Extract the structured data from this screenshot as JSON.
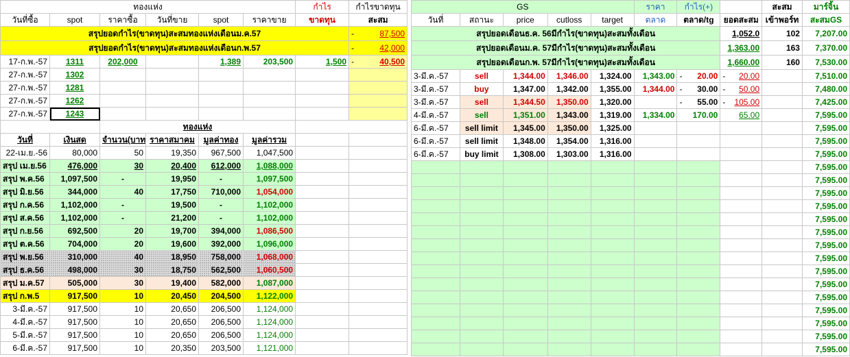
{
  "left": {
    "header1": {
      "gold": "ทองแห่ง",
      "profit": "กำไร",
      "profit_loss": "กำไรขาดทุน"
    },
    "header2": {
      "buy_date": "วันที่ซื้อ",
      "spot1": "spot",
      "buy_price": "ราคาซื้อ",
      "sell_date": "วันที่ขาย",
      "spot2": "spot",
      "sell_price": "ราคาขาย",
      "loss": "ขาดทุน",
      "cum": "สะสม"
    },
    "summary_rows": [
      {
        "label": "สรุปยอดกำไร(ขาดทุน)สะสมทองแห่งเดือนม.ค.57",
        "dash": "-",
        "value": "87,500"
      },
      {
        "label": "สรุปยอดกำไร(ขาดทุน)สะสมทองแห่งเดือนก.พ.57",
        "dash": "-",
        "value": "42,000"
      }
    ],
    "trade_rows": [
      {
        "date": "17-ก.พ.-57",
        "spot": "1311",
        "buy": "202,000",
        "sdate": "",
        "spot2": "1,389",
        "sell": "203,500",
        "pl": "1,500",
        "dash": "-",
        "cum": "40,500"
      },
      {
        "date": "27-ก.พ.-57",
        "spot": "1302"
      },
      {
        "date": "27-ก.พ.-57",
        "spot": "1281"
      },
      {
        "date": "27-ก.พ.-57",
        "spot": "1262"
      },
      {
        "date": "27-ก.พ.-57",
        "spot": "1243"
      }
    ],
    "gold_section_title": "ทองแห่ง",
    "gold_headers": {
      "date": "วันที่",
      "cash": "เงินสด",
      "qty": "จำนวน(บาท",
      "assoc": "ราคาสมาคม",
      "gold_value": "มูลค่าทอง",
      "total_value": "มูลค่ารวม"
    },
    "gold_rows": [
      {
        "date": "22-เม.ย.-56",
        "cash": "80,000",
        "qty": "50",
        "assoc": "19,350",
        "gv": "967,500",
        "tv": "1,047,500",
        "style": "plain"
      },
      {
        "date": "สรุป เม.ย.56",
        "cash": "476,000",
        "qty": "30",
        "assoc": "20,400",
        "gv": "612,000",
        "tv": "1,088,000",
        "style": "green-u",
        "tvc": "grn"
      },
      {
        "date": "สรุป พ.ค.56",
        "cash": "1,097,500",
        "qty": "-",
        "assoc": "19,950",
        "gv": "-",
        "tv": "1,097,500",
        "style": "green",
        "tvc": "grn"
      },
      {
        "date": "สรุป มิ.ย.56",
        "cash": "344,000",
        "qty": "40",
        "assoc": "17,750",
        "gv": "710,000",
        "tv": "1,054,000",
        "style": "green",
        "tvc": "red"
      },
      {
        "date": "สรุป ก.ค.56",
        "cash": "1,102,000",
        "qty": "-",
        "assoc": "19,500",
        "gv": "-",
        "tv": "1,102,000",
        "style": "green",
        "tvc": "grn"
      },
      {
        "date": "สรุป ส.ค.56",
        "cash": "1,102,000",
        "qty": "-",
        "assoc": "21,200",
        "gv": "-",
        "tv": "1,102,000",
        "style": "green",
        "tvc": "grn"
      },
      {
        "date": "สรุป ก.ย.56",
        "cash": "692,500",
        "qty": "20",
        "assoc": "19,700",
        "gv": "394,000",
        "tv": "1,086,500",
        "style": "green",
        "tvc": "red"
      },
      {
        "date": "สรุป ต.ค.56",
        "cash": "704,000",
        "qty": "20",
        "assoc": "19,600",
        "gv": "392,000",
        "tv": "1,096,000",
        "style": "green",
        "tvc": "grn"
      },
      {
        "date": "สรุป พ.ย.56",
        "cash": "310,000",
        "qty": "40",
        "assoc": "18,950",
        "gv": "758,000",
        "tv": "1,068,000",
        "style": "dot",
        "tvc": "red"
      },
      {
        "date": "สรุป ธ.ค.56",
        "cash": "498,000",
        "qty": "30",
        "assoc": "18,750",
        "gv": "562,500",
        "tv": "1,060,500",
        "style": "dot",
        "tvc": "red"
      },
      {
        "date": "สรุป ม.ค.57",
        "cash": "505,000",
        "qty": "30",
        "assoc": "19,400",
        "gv": "582,000",
        "tv": "1,087,000",
        "style": "tan",
        "tvc": "grn"
      },
      {
        "date": "สรุป ก.พ.5",
        "cash": "917,500",
        "qty": "10",
        "assoc": "20,450",
        "gv": "204,500",
        "tv": "1,122,000",
        "style": "yellow",
        "tvc": "grn"
      },
      {
        "date": "3-มี.ค.-57",
        "cash": "917,500",
        "qty": "10",
        "assoc": "20,650",
        "gv": "206,500",
        "tv": "1,124,000",
        "style": "plain",
        "tvc": "grn"
      },
      {
        "date": "4-มี.ค.-57",
        "cash": "917,500",
        "qty": "10",
        "assoc": "20,650",
        "gv": "206,500",
        "tv": "1,124,000",
        "style": "plain",
        "tvc": "grn"
      },
      {
        "date": "5-มี.ค.-57",
        "cash": "917,500",
        "qty": "10",
        "assoc": "20,650",
        "gv": "206,500",
        "tv": "1,124,000",
        "style": "plain",
        "tvc": "grn"
      },
      {
        "date": "6-มี.ค.-57",
        "cash": "917,500",
        "qty": "10",
        "assoc": "20,350",
        "gv": "203,500",
        "tv": "1,121,000",
        "style": "plain",
        "tvc": "grn"
      }
    ]
  },
  "right": {
    "header1": {
      "gs": "GS",
      "price": "ราคา",
      "profit": "กำไร(+)",
      "cum": "สะสม",
      "margin": "มาร์จิ้น"
    },
    "header2": {
      "date": "วันที่",
      "status": "สถานะ",
      "price": "price",
      "cutloss": "cutloss",
      "target": "target",
      "market": "ตลาด",
      "market_tg": "ตลาด/tg",
      "cum_total": "ยอดสะสม",
      "port": "เข้าพอร์ท",
      "cum_gs": "สะสมGS"
    },
    "summary_rows": [
      {
        "label": "สรุปยอดเดือนธ.ค. 56มีกำไร(ขาดทุน)สะสมทั้งเดือน",
        "total": "1,052.0",
        "port": "102",
        "margin": "7,207.00",
        "green": false
      },
      {
        "label": "สรุปยอดเดือนม.ค. 57มีกำไร(ขาดทุน)สะสมทั้งเดือน",
        "total": "1,363.00",
        "port": "163",
        "margin": "7,370.00",
        "green": true
      },
      {
        "label": "สรุปยอดเดือนก.พ. 57มีกำไร(ขาดทุน)สะสมทั้งเดือน",
        "total": "1,660.00",
        "port": "160",
        "margin": "7,530.00",
        "green": true
      }
    ],
    "trades": [
      {
        "date": "3-มี.ค.-57",
        "status": "sell",
        "sc": "red",
        "price": "1,344.00",
        "pc": "red",
        "cut": "1,346.00",
        "cc": "red",
        "target": "1,324.00",
        "market": "1,343.00",
        "mc": "grn",
        "d1": "-",
        "tg": "20.00",
        "tgc": "red",
        "d2": "-",
        "cum": "20.00",
        "cumc": "red",
        "margin": "7,510.00",
        "tan": false
      },
      {
        "date": "3-มี.ค.-57",
        "status": "buy",
        "sc": "red",
        "price": "1,347.00",
        "pc": "",
        "cut": "1,342.00",
        "cc": "",
        "target": "1,355.00",
        "market": "1,344.00",
        "mc": "red",
        "d1": "-",
        "tg": "30.00",
        "tgc": "",
        "d2": "-",
        "cum": "50.00",
        "cumc": "red",
        "margin": "7,480.00",
        "tan": false
      },
      {
        "date": "3-มี.ค.-57",
        "status": "sell",
        "sc": "red",
        "price": "1,344.50",
        "pc": "red",
        "cut": "1,350.00",
        "cc": "red",
        "target": "1,320.00",
        "market": "",
        "mc": "",
        "d1": "-",
        "tg": "55.00",
        "tgc": "",
        "d2": "-",
        "cum": "105.00",
        "cumc": "red",
        "margin": "7,425.00",
        "tan": true
      },
      {
        "date": "4-มี.ค.-57",
        "status": "sell",
        "sc": "grn",
        "price": "1,351.00",
        "pc": "grn",
        "cut": "1,343.00",
        "cc": "",
        "target": "1,319.00",
        "market": "1,334.00",
        "mc": "grn",
        "d1": "",
        "tg": "170.00",
        "tgc": "grn",
        "d2": "",
        "cum": "65.00",
        "cumc": "grn",
        "margin": "7,595.00",
        "tan": true
      },
      {
        "date": "6-มี.ค.-57",
        "status": "sell limit",
        "sc": "",
        "price": "1,345.00",
        "pc": "",
        "cut": "1,350.00",
        "cc": "",
        "target": "1,325.00",
        "market": "",
        "mc": "",
        "d1": "",
        "tg": "",
        "tgc": "",
        "d2": "",
        "cum": "",
        "cumc": "",
        "margin": "7,595.00",
        "tan": true
      },
      {
        "date": "6-มี.ค.-57",
        "status": "sell limit",
        "sc": "",
        "price": "1,348.00",
        "pc": "",
        "cut": "1,354.00",
        "cc": "",
        "target": "1,316.00",
        "market": "",
        "mc": "",
        "d1": "",
        "tg": "",
        "tgc": "",
        "d2": "",
        "cum": "",
        "cumc": "",
        "margin": "7,595.00",
        "tan": false
      },
      {
        "date": "6-มี.ค.-57",
        "status": "buy limit",
        "sc": "",
        "price": "1,308.00",
        "pc": "",
        "cut": "1,303.00",
        "cc": "",
        "target": "1,316.00",
        "market": "",
        "mc": "",
        "d1": "",
        "tg": "",
        "tgc": "",
        "d2": "",
        "cum": "",
        "cumc": "",
        "margin": "7,595.00",
        "tan": false
      }
    ],
    "empty_margin": "7,595.00",
    "empty_rows": 15
  }
}
